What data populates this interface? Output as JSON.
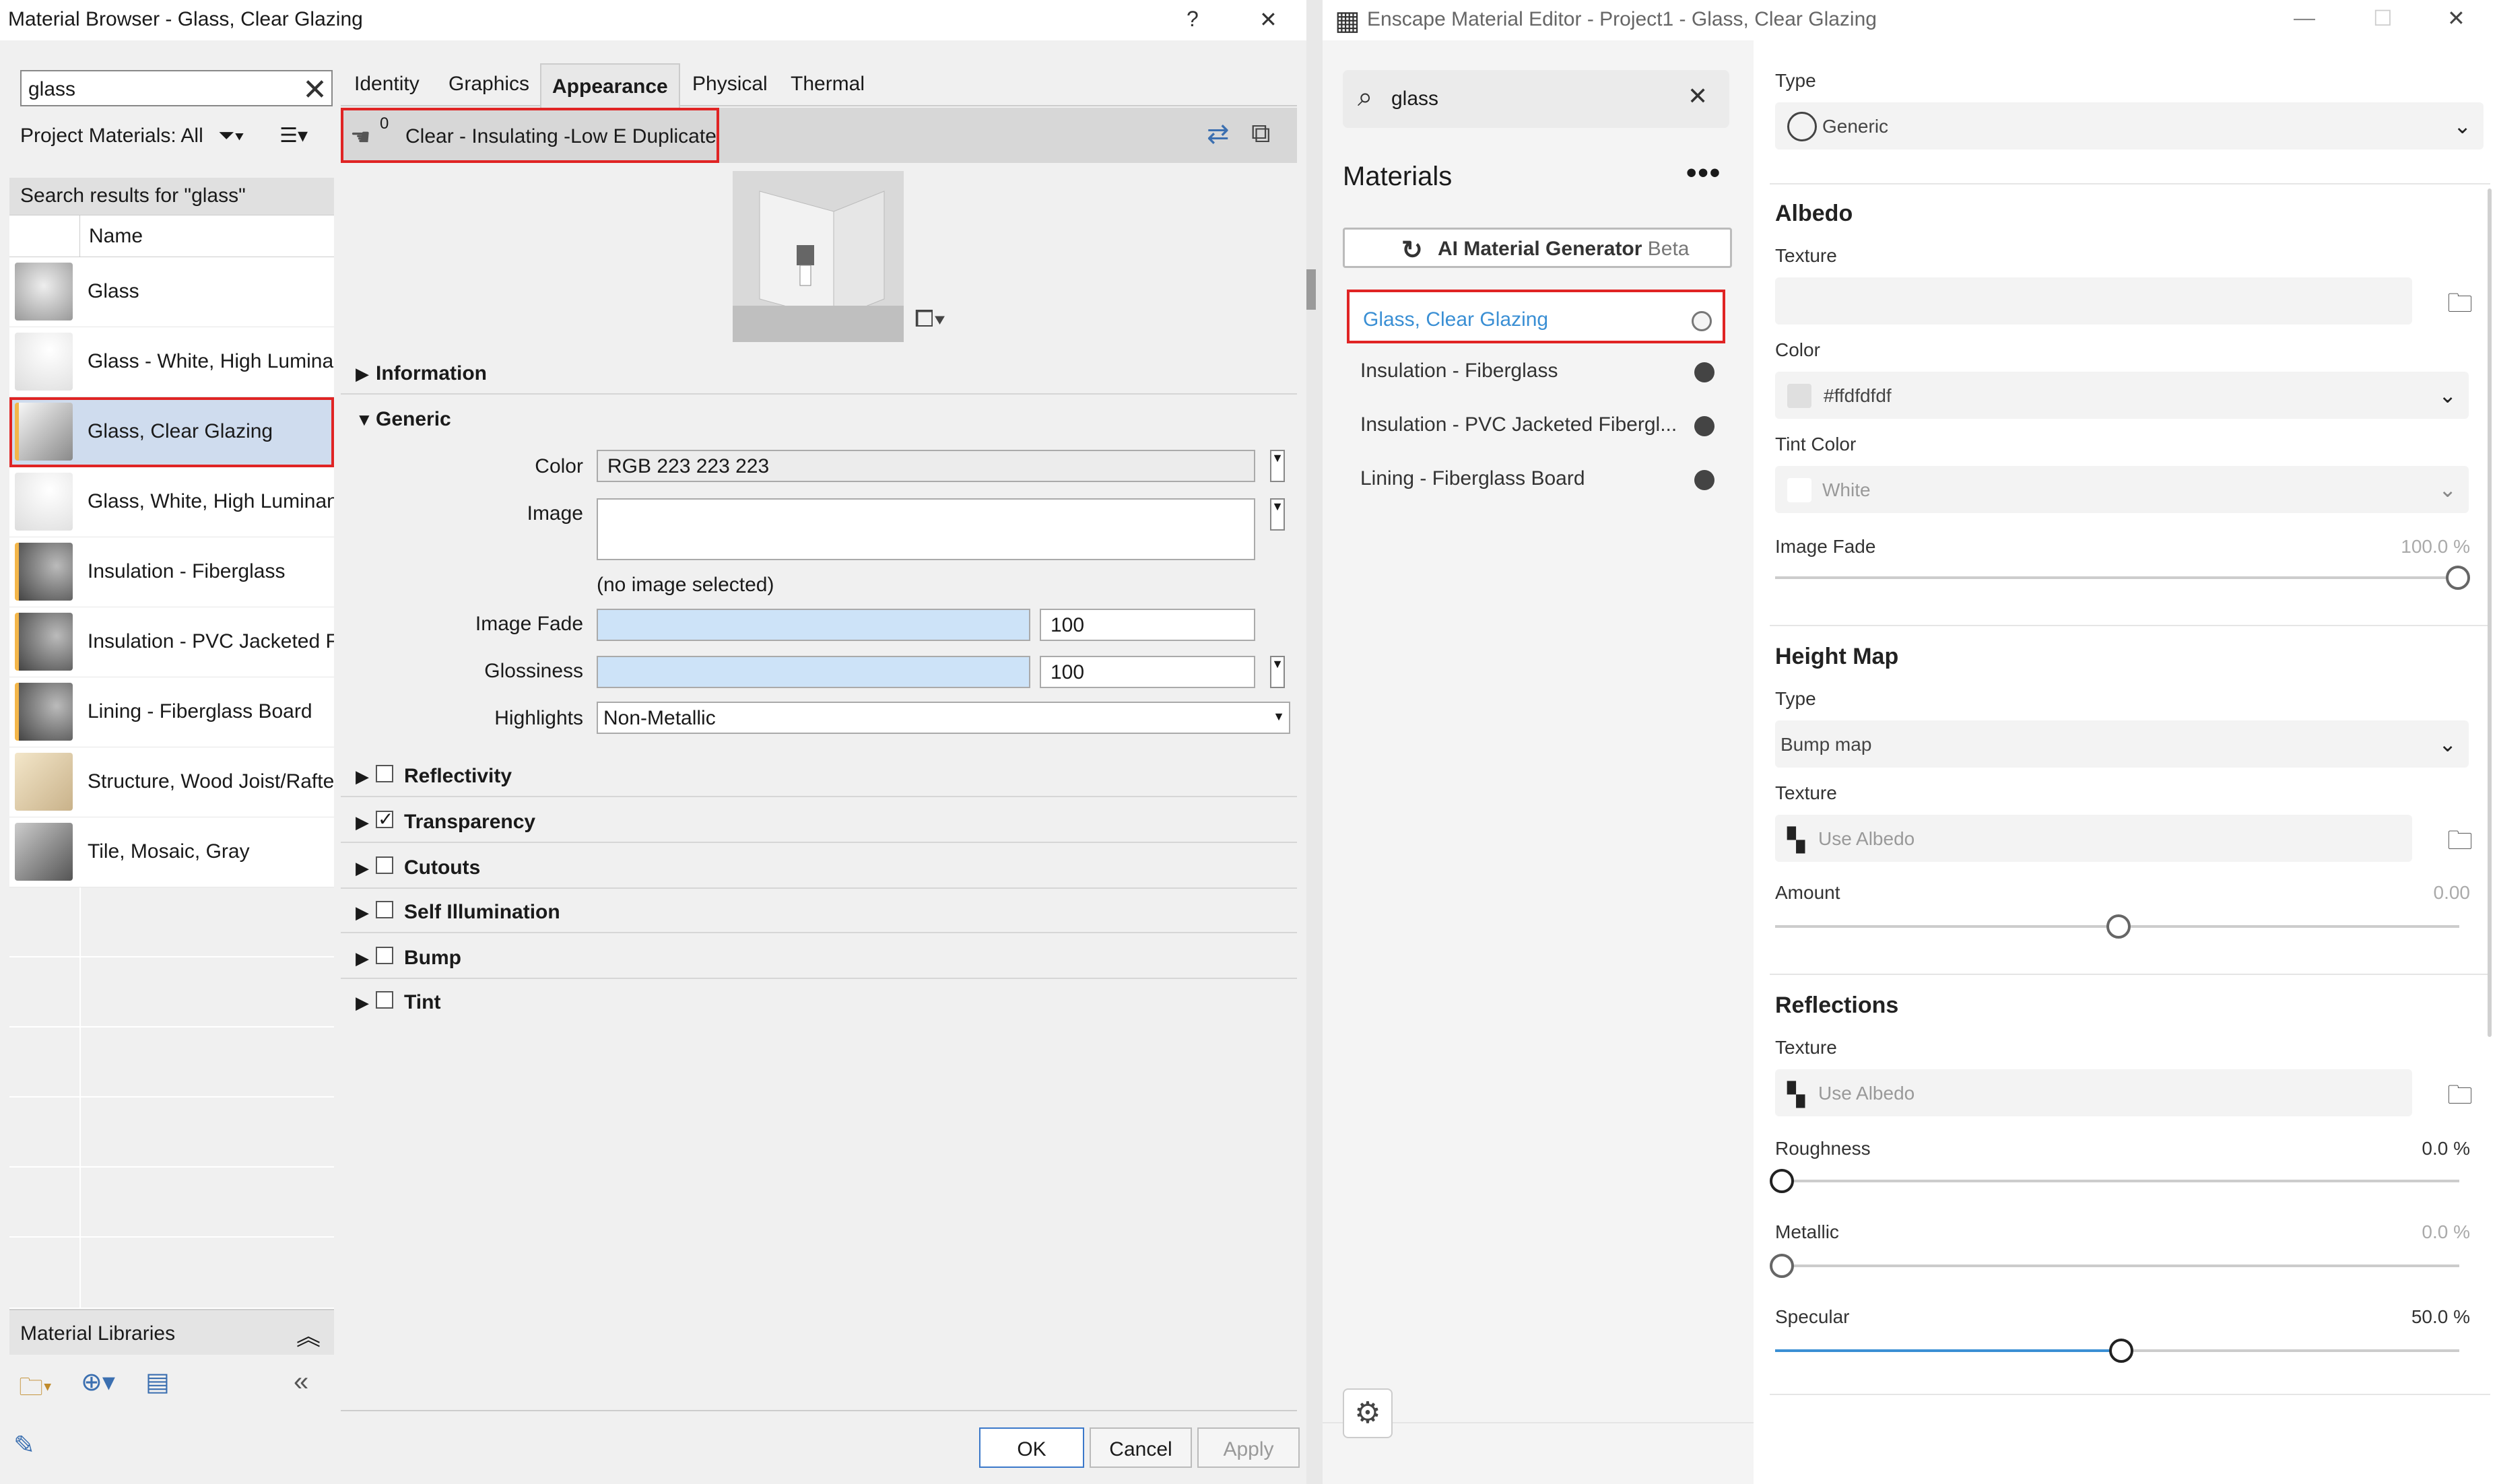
{
  "material_browser": {
    "title": "Material Browser - Glass, Clear Glazing",
    "help": "?",
    "close": "✕",
    "search_value": "glass",
    "project_materials": "Project Materials: All",
    "search_results": "Search results for \"glass\"",
    "column_name": "Name",
    "materials": [
      {
        "name": "Glass"
      },
      {
        "name": "Glass - White, High Luminance"
      },
      {
        "name": "Glass, Clear Glazing"
      },
      {
        "name": "Glass, White, High Luminance"
      },
      {
        "name": "Insulation - Fiberglass"
      },
      {
        "name": "Insulation - PVC Jacketed Fiberglass"
      },
      {
        "name": "Lining - Fiberglass Board"
      },
      {
        "name": "Structure, Wood Joist/Rafter Layer"
      },
      {
        "name": "Tile, Mosaic, Gray"
      }
    ],
    "libraries_label": "Material Libraries",
    "tabs": [
      "Identity",
      "Graphics",
      "Appearance",
      "Physical",
      "Thermal"
    ],
    "asset_count": "0",
    "asset_name": "Clear - Insulating -Low E Duplicate",
    "sections": {
      "information": "Information",
      "generic": "Generic"
    },
    "properties": {
      "color_label": "Color",
      "color_value": "RGB 223 223 223",
      "image_label": "Image",
      "no_image": "(no image selected)",
      "image_fade_label": "Image Fade",
      "image_fade_value": "100",
      "glossiness_label": "Glossiness",
      "glossiness_value": "100",
      "highlights_label": "Highlights",
      "highlights_value": "Non-Metallic"
    },
    "checkbox_sections": [
      {
        "label": "Reflectivity",
        "checked": false
      },
      {
        "label": "Transparency",
        "checked": true
      },
      {
        "label": "Cutouts",
        "checked": false
      },
      {
        "label": "Self Illumination",
        "checked": false
      },
      {
        "label": "Bump",
        "checked": false
      },
      {
        "label": "Tint",
        "checked": false
      }
    ],
    "buttons": {
      "ok": "OK",
      "cancel": "Cancel",
      "apply": "Apply"
    }
  },
  "enscape": {
    "title": "Enscape Material Editor - Project1 - Glass, Clear Glazing",
    "search_value": "glass",
    "materials_heading": "Materials",
    "more": "•••",
    "ai_button": "AI Material Generator",
    "ai_beta": "Beta",
    "items": [
      {
        "label": "Glass, Clear Glazing"
      },
      {
        "label": "Insulation - Fiberglass"
      },
      {
        "label": "Insulation - PVC Jacketed Fibergl..."
      },
      {
        "label": "Lining - Fiberglass Board"
      }
    ],
    "type_label": "Type",
    "type_value": "Generic",
    "albedo": {
      "heading": "Albedo",
      "texture_label": "Texture",
      "color_label": "Color",
      "color_value": "#ffdfdfdf",
      "tint_label": "Tint Color",
      "tint_value": "White",
      "fade_label": "Image Fade",
      "fade_value": "100.0 %"
    },
    "height_map": {
      "heading": "Height Map",
      "type_label": "Type",
      "type_value": "Bump map",
      "texture_label": "Texture",
      "texture_value": "Use Albedo",
      "amount_label": "Amount",
      "amount_value": "0.00"
    },
    "reflections": {
      "heading": "Reflections",
      "texture_label": "Texture",
      "texture_value": "Use Albedo",
      "roughness_label": "Roughness",
      "roughness_value": "0.0 %",
      "metallic_label": "Metallic",
      "metallic_value": "0.0 %",
      "specular_label": "Specular",
      "specular_value": "50.0 %"
    },
    "colors": {
      "accent": "#3a8fd4",
      "highlight": "#e02424"
    }
  }
}
